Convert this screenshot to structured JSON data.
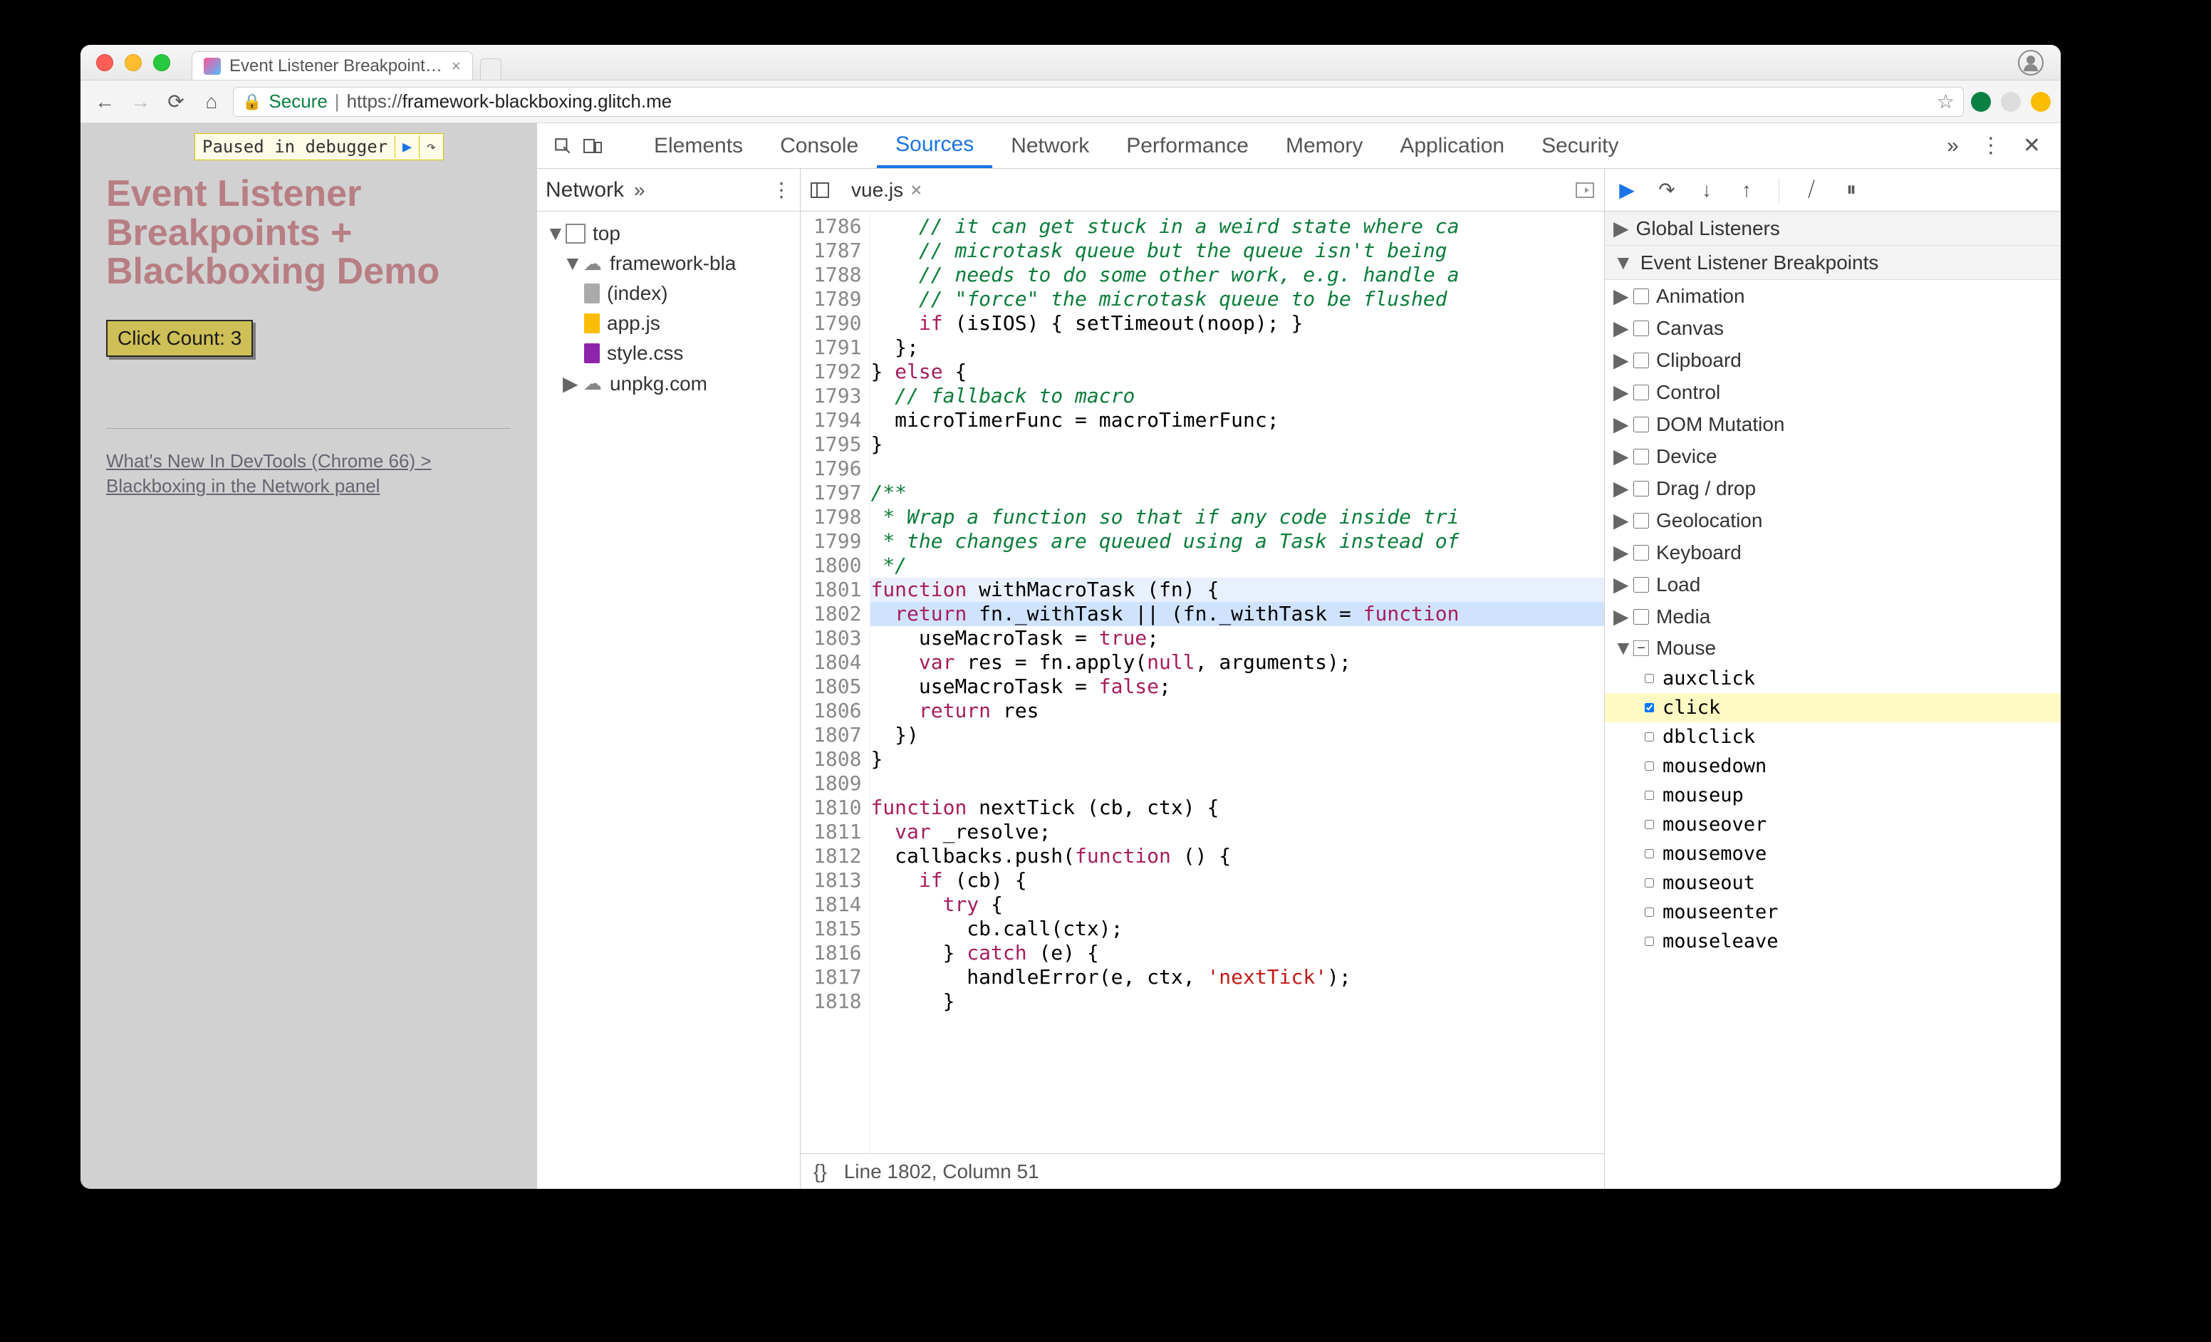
{
  "browser": {
    "tab_title": "Event Listener Breakpoints + B",
    "secure_label": "Secure",
    "url_prefix": "https://",
    "url_host": "framework-blackboxing.glitch.me",
    "pause_badge": "Paused in debugger"
  },
  "page": {
    "heading": "Event Listener Breakpoints + Blackboxing Demo",
    "button_label": "Click Count: 3",
    "link_text": "What's New In DevTools (Chrome 66) > Blackboxing in the Network panel"
  },
  "devtools": {
    "tabs": [
      "Elements",
      "Console",
      "Sources",
      "Network",
      "Performance",
      "Memory",
      "Application",
      "Security"
    ],
    "active_tab": "Sources",
    "more_glyph": "»",
    "navigator": {
      "primary": "Network",
      "tree": [
        {
          "level": 0,
          "type": "frame",
          "label": "top",
          "expanded": true
        },
        {
          "level": 1,
          "type": "cloud",
          "label": "framework-bla",
          "expanded": true
        },
        {
          "level": 2,
          "type": "file",
          "label": "(index)"
        },
        {
          "level": 2,
          "type": "js",
          "label": "app.js"
        },
        {
          "level": 2,
          "type": "css",
          "label": "style.css"
        },
        {
          "level": 1,
          "type": "cloud",
          "label": "unpkg.com",
          "expanded": false
        }
      ]
    },
    "editor": {
      "filename": "vue.js",
      "status": "Line 1802, Column 51",
      "lines": [
        {
          "n": 1786,
          "t": "    // it can get stuck in a weird state where ca",
          "cls": "cm"
        },
        {
          "n": 1787,
          "t": "    // microtask queue but the queue isn't being",
          "cls": "cm"
        },
        {
          "n": 1788,
          "t": "    // needs to do some other work, e.g. handle a",
          "cls": "cm"
        },
        {
          "n": 1789,
          "t": "    // \"force\" the microtask queue to be flushed",
          "cls": "cm"
        },
        {
          "n": 1790,
          "t": "    if (isIOS) { setTimeout(noop); }",
          "cls": ""
        },
        {
          "n": 1791,
          "t": "  };",
          "cls": ""
        },
        {
          "n": 1792,
          "t": "} else {",
          "cls": ""
        },
        {
          "n": 1793,
          "t": "  // fallback to macro",
          "cls": "cm"
        },
        {
          "n": 1794,
          "t": "  microTimerFunc = macroTimerFunc;",
          "cls": ""
        },
        {
          "n": 1795,
          "t": "}",
          "cls": ""
        },
        {
          "n": 1796,
          "t": "",
          "cls": ""
        },
        {
          "n": 1797,
          "t": "/**",
          "cls": "cm"
        },
        {
          "n": 1798,
          "t": " * Wrap a function so that if any code inside tri",
          "cls": "cm"
        },
        {
          "n": 1799,
          "t": " * the changes are queued using a Task instead of",
          "cls": "cm"
        },
        {
          "n": 1800,
          "t": " */",
          "cls": "cm"
        },
        {
          "n": 1801,
          "t": "function withMacroTask (fn) {",
          "cls": "",
          "hl": "hl"
        },
        {
          "n": 1802,
          "t": "  return fn._withTask || (fn._withTask = function",
          "cls": "",
          "hl": "cur"
        },
        {
          "n": 1803,
          "t": "    useMacroTask = true;",
          "cls": ""
        },
        {
          "n": 1804,
          "t": "    var res = fn.apply(null, arguments);",
          "cls": ""
        },
        {
          "n": 1805,
          "t": "    useMacroTask = false;",
          "cls": ""
        },
        {
          "n": 1806,
          "t": "    return res",
          "cls": ""
        },
        {
          "n": 1807,
          "t": "  })",
          "cls": ""
        },
        {
          "n": 1808,
          "t": "}",
          "cls": ""
        },
        {
          "n": 1809,
          "t": "",
          "cls": ""
        },
        {
          "n": 1810,
          "t": "function nextTick (cb, ctx) {",
          "cls": ""
        },
        {
          "n": 1811,
          "t": "  var _resolve;",
          "cls": ""
        },
        {
          "n": 1812,
          "t": "  callbacks.push(function () {",
          "cls": ""
        },
        {
          "n": 1813,
          "t": "    if (cb) {",
          "cls": ""
        },
        {
          "n": 1814,
          "t": "      try {",
          "cls": ""
        },
        {
          "n": 1815,
          "t": "        cb.call(ctx);",
          "cls": ""
        },
        {
          "n": 1816,
          "t": "      } catch (e) {",
          "cls": ""
        },
        {
          "n": 1817,
          "t": "        handleError(e, ctx, 'nextTick');",
          "cls": ""
        },
        {
          "n": 1818,
          "t": "      }",
          "cls": ""
        }
      ]
    },
    "right": {
      "sections": [
        "Global Listeners",
        "Event Listener Breakpoints"
      ],
      "categories": [
        {
          "name": "Animation"
        },
        {
          "name": "Canvas"
        },
        {
          "name": "Clipboard"
        },
        {
          "name": "Control"
        },
        {
          "name": "DOM Mutation"
        },
        {
          "name": "Device"
        },
        {
          "name": "Drag / drop"
        },
        {
          "name": "Geolocation"
        },
        {
          "name": "Keyboard"
        },
        {
          "name": "Load"
        },
        {
          "name": "Media"
        }
      ],
      "open_category": "Mouse",
      "mouse_events": [
        {
          "name": "auxclick",
          "checked": false
        },
        {
          "name": "click",
          "checked": true,
          "highlight": true
        },
        {
          "name": "dblclick",
          "checked": false
        },
        {
          "name": "mousedown",
          "checked": false
        },
        {
          "name": "mouseup",
          "checked": false
        },
        {
          "name": "mouseover",
          "checked": false
        },
        {
          "name": "mousemove",
          "checked": false
        },
        {
          "name": "mouseout",
          "checked": false
        },
        {
          "name": "mouseenter",
          "checked": false
        },
        {
          "name": "mouseleave",
          "checked": false
        }
      ]
    }
  }
}
